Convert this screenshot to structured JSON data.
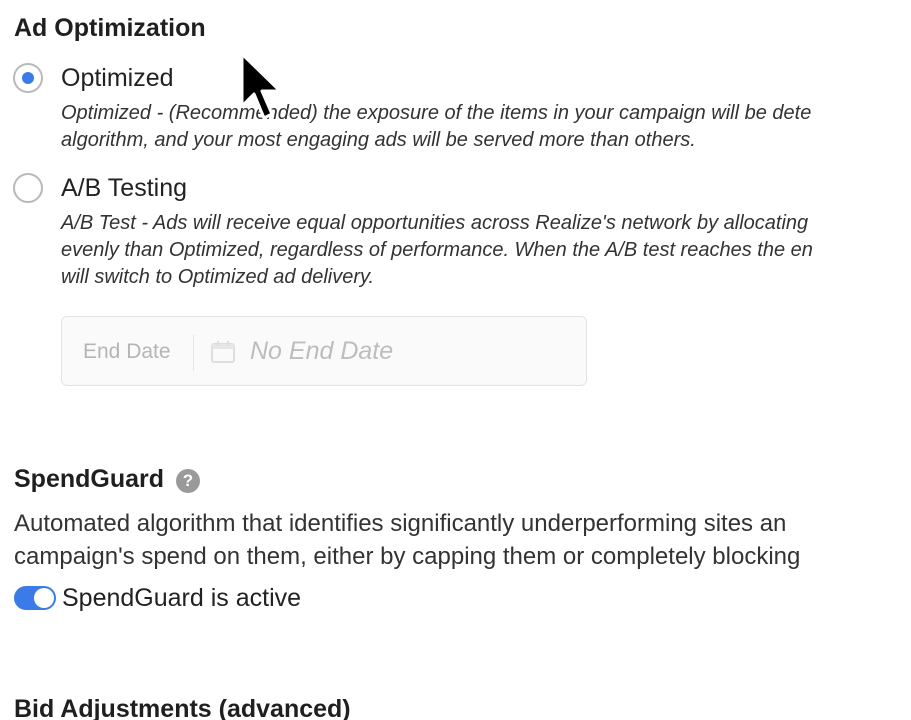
{
  "ad_optimization": {
    "title": "Ad Optimization",
    "options": [
      {
        "label": "Optimized",
        "selected": true,
        "description_line1": "Optimized - (Recommended) the exposure of the items in your campaign will be dete",
        "description_line2": "algorithm, and your most engaging ads will be served more than others."
      },
      {
        "label": "A/B Testing",
        "selected": false,
        "description_line1": "A/B Test - Ads will receive equal opportunities across Realize's network by allocating",
        "description_line2": "evenly than Optimized, regardless of performance. When the A/B test reaches the en",
        "description_line3": "will switch to Optimized ad delivery."
      }
    ],
    "end_date": {
      "label": "End Date",
      "value": "No End Date",
      "icon": "calendar-icon"
    }
  },
  "spendguard": {
    "title": "SpendGuard",
    "help_icon": "question-icon",
    "help_glyph": "?",
    "description_line1": "Automated algorithm that identifies significantly underperforming sites an",
    "description_line2": "campaign's spend on them, either by capping them or completely blocking",
    "toggle_on": true,
    "toggle_label": "SpendGuard is active"
  },
  "bid_adjustments": {
    "title": "Bid Adjustments (advanced)"
  },
  "colors": {
    "accent": "#3b7be8",
    "radio_border": "#b9b9b9",
    "disabled_text": "#bdbdbd"
  }
}
